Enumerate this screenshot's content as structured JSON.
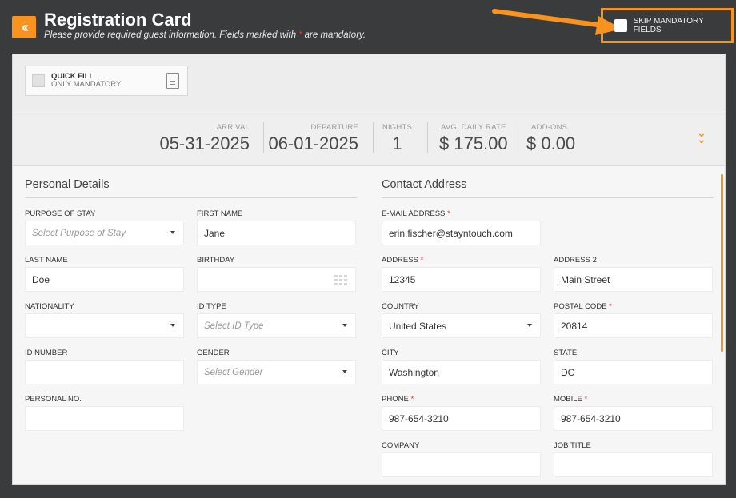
{
  "header": {
    "back_icon": "double-chevron-left",
    "title": "Registration Card",
    "subtitle_before": "Please provide required guest information. Fields marked with",
    "subtitle_star": "*",
    "subtitle_after": "are mandatory.",
    "skip_label": "SKIP MANDATORY FIELDS",
    "accent": "#f7931e"
  },
  "quickfill": {
    "label": "QUICK FILL",
    "sublabel": "ONLY MANDATORY",
    "icon": "document-icon"
  },
  "stats": [
    {
      "label": "ARRIVAL",
      "value": "05-31-2025"
    },
    {
      "label": "DEPARTURE",
      "value": "06-01-2025"
    },
    {
      "label": "NIGHTS",
      "value": "1"
    },
    {
      "label": "AVG. DAILY RATE",
      "value": "$ 175.00"
    },
    {
      "label": "ADD-ONS",
      "value": "$ 0.00"
    }
  ],
  "personal": {
    "title": "Personal Details",
    "purpose": {
      "label": "PURPOSE OF STAY",
      "placeholder": "Select Purpose of Stay"
    },
    "first_name": {
      "label": "FIRST NAME",
      "value": "Jane"
    },
    "last_name": {
      "label": "LAST NAME",
      "value": "Doe"
    },
    "birthday": {
      "label": "BIRTHDAY",
      "value": ""
    },
    "nationality": {
      "label": "NATIONALITY",
      "value": ""
    },
    "id_type": {
      "label": "ID TYPE",
      "placeholder": "Select ID Type"
    },
    "id_number": {
      "label": "ID NUMBER",
      "value": ""
    },
    "gender": {
      "label": "GENDER",
      "placeholder": "Select Gender"
    },
    "personal_no": {
      "label": "PERSONAL NO.",
      "value": ""
    }
  },
  "contact": {
    "title": "Contact Address",
    "email": {
      "label": "E-MAIL ADDRESS",
      "value": "erin.fischer@stayntouch.com"
    },
    "address": {
      "label": "ADDRESS",
      "value": "12345"
    },
    "address2": {
      "label": "ADDRESS 2",
      "value": "Main Street"
    },
    "country": {
      "label": "COUNTRY",
      "value": "United States"
    },
    "postal": {
      "label": "POSTAL CODE",
      "value": "20814"
    },
    "city": {
      "label": "CITY",
      "value": "Washington"
    },
    "state": {
      "label": "STATE",
      "value": "DC"
    },
    "phone": {
      "label": "PHONE",
      "value": "987-654-3210"
    },
    "mobile": {
      "label": "MOBILE",
      "value": "987-654-3210"
    },
    "company": {
      "label": "COMPANY",
      "value": ""
    },
    "job_title": {
      "label": "JOB TITLE",
      "value": ""
    },
    "required_marker": "*"
  }
}
